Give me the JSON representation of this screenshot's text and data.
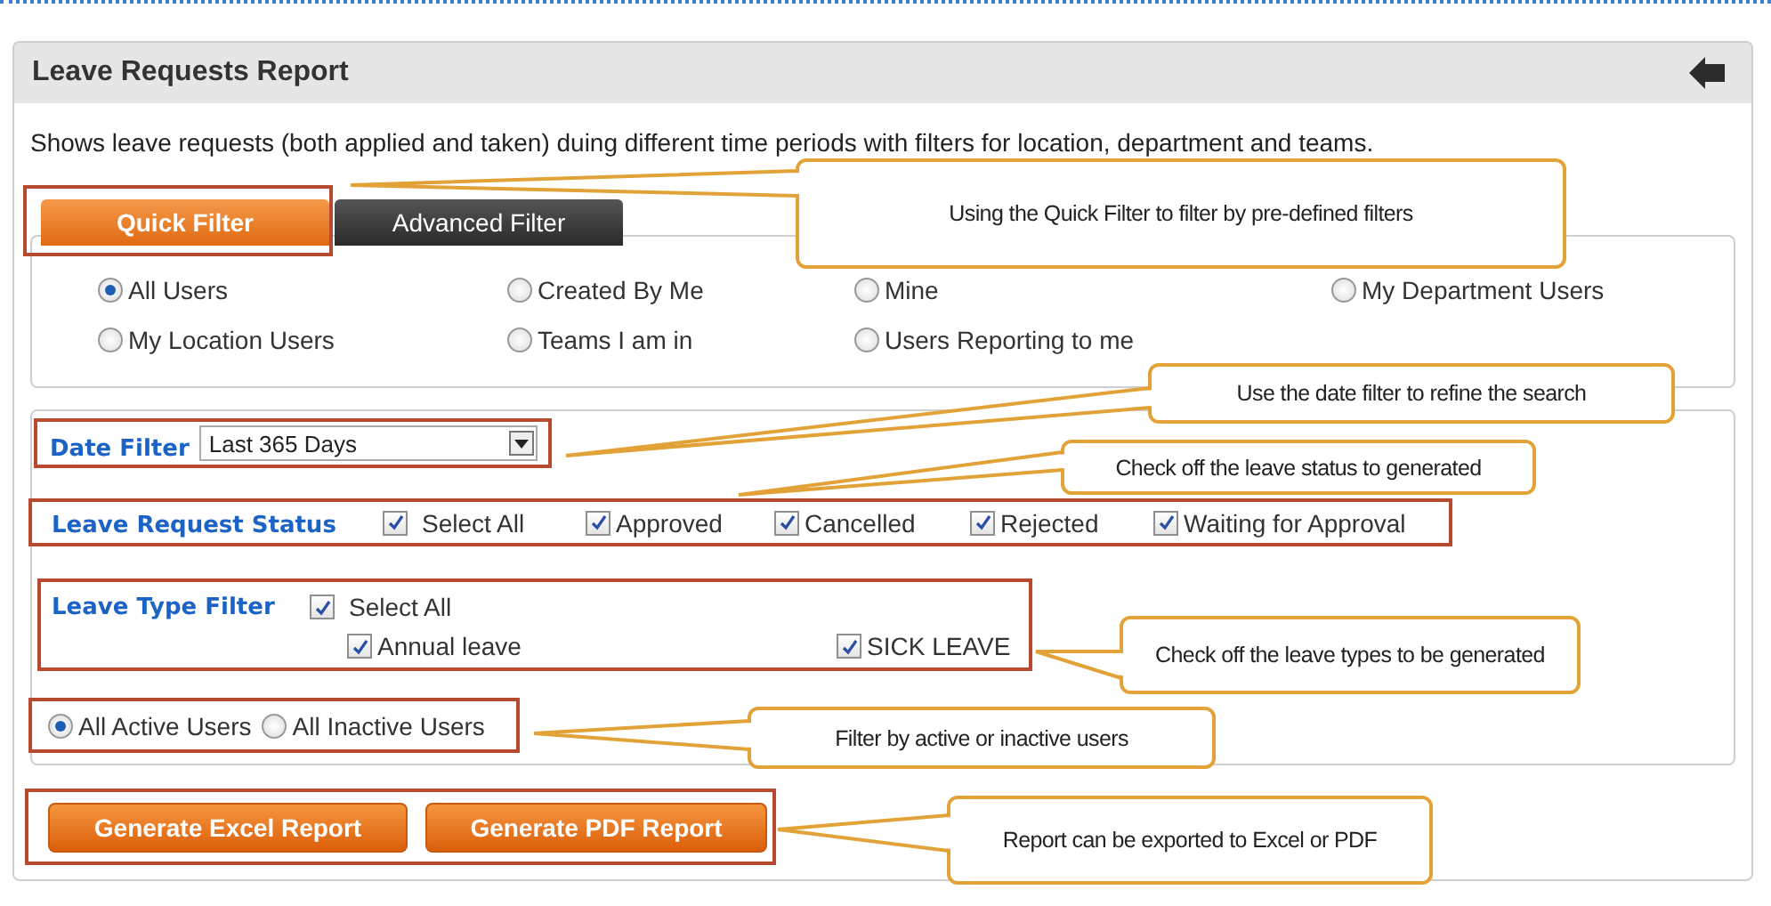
{
  "header": {
    "title": "Leave Requests Report"
  },
  "description": "Shows leave requests (both applied and taken) duing different time periods with filters for location, department and teams.",
  "tabs": [
    {
      "label": "Quick Filter",
      "selected": true
    },
    {
      "label": "Advanced Filter",
      "selected": false
    }
  ],
  "quick_filter": [
    {
      "label": "All Users",
      "selected": true
    },
    {
      "label": "Created By Me",
      "selected": false
    },
    {
      "label": "Mine",
      "selected": false
    },
    {
      "label": "My Department Users",
      "selected": false
    },
    {
      "label": "My Location Users",
      "selected": false
    },
    {
      "label": "Teams I am in",
      "selected": false
    },
    {
      "label": "Users Reporting to me",
      "selected": false
    }
  ],
  "date_filter": {
    "label": "Date Filter",
    "value": "Last 365 Days"
  },
  "leave_request_status": {
    "label": "Leave Request Status",
    "options": [
      {
        "label": "Select All",
        "checked": true
      },
      {
        "label": "Approved",
        "checked": true
      },
      {
        "label": "Cancelled",
        "checked": true
      },
      {
        "label": "Rejected",
        "checked": true
      },
      {
        "label": "Waiting for Approval",
        "checked": true
      }
    ]
  },
  "leave_type_filter": {
    "label": "Leave Type Filter",
    "select_all": {
      "label": "Select All",
      "checked": true
    },
    "types": [
      {
        "label": "Annual leave",
        "checked": true
      },
      {
        "label": "SICK LEAVE",
        "checked": true
      }
    ]
  },
  "user_status": [
    {
      "label": "All Active Users",
      "selected": true
    },
    {
      "label": "All Inactive Users",
      "selected": false
    }
  ],
  "buttons": [
    "Generate Excel Report",
    "Generate PDF Report"
  ],
  "callouts": [
    {
      "text": "Using the Quick Filter to filter by pre-defined filters"
    },
    {
      "text": "Use the date filter to refine the search"
    },
    {
      "text": "Check off the leave status to generated"
    },
    {
      "text": "Check off the leave types to be generated"
    },
    {
      "text": "Filter by active or inactive users"
    },
    {
      "text": "Report can be exported to Excel or PDF"
    }
  ]
}
